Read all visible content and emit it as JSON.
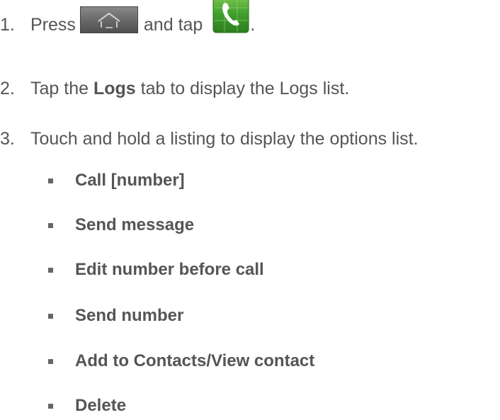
{
  "steps": [
    {
      "number": "1.",
      "text_before": "Press",
      "icon_home": "home-key-icon",
      "text_middle": "and tap",
      "icon_phone": "phone-app-icon",
      "text_after": "."
    },
    {
      "number": "2.",
      "text_before": "Tap the",
      "bold": "Logs",
      "text_after": "tab to display the Logs list."
    },
    {
      "number": "3.",
      "text": "Touch and hold a listing to display the options list."
    }
  ],
  "options": [
    "Call [number]",
    "Send message",
    "Edit number before call",
    "Send number",
    "Add to Contacts/View contact",
    "Delete"
  ],
  "colors": {
    "text": "#555555",
    "phone_green": "#3a9a2a",
    "home_key_gray": "#6f6f6f"
  }
}
